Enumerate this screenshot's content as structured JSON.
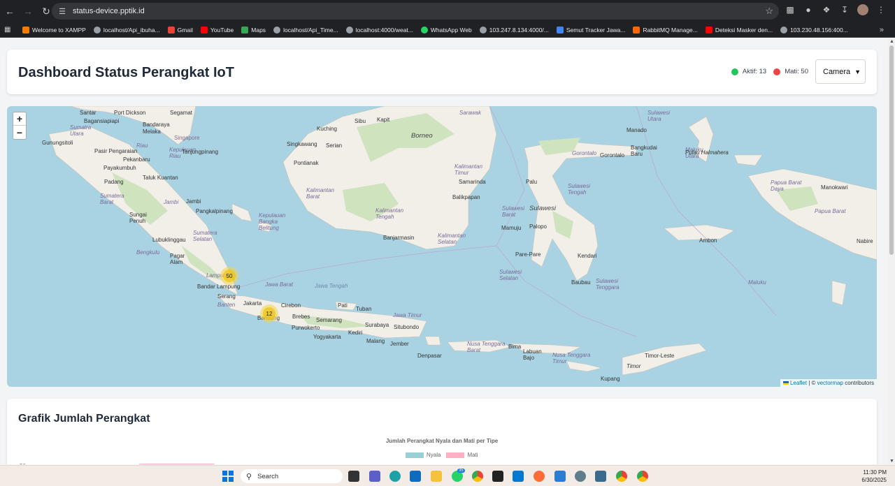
{
  "browser": {
    "url": "status-device.pptik.id",
    "bookmarks": [
      {
        "label": "Welcome to XAMPP",
        "color": "#f57c00"
      },
      {
        "label": "localhost/Api_ibuha...",
        "color": "#9aa0a6"
      },
      {
        "label": "Gmail",
        "color": "#ea4335"
      },
      {
        "label": "YouTube",
        "color": "#ff0000"
      },
      {
        "label": "Maps",
        "color": "#34a853"
      },
      {
        "label": "localhost/Api_Time...",
        "color": "#9aa0a6"
      },
      {
        "label": "localhost:4000/weat...",
        "color": "#9aa0a6"
      },
      {
        "label": "WhatsApp Web",
        "color": "#25d366"
      },
      {
        "label": "103.247.8.134:4000/...",
        "color": "#9aa0a6"
      },
      {
        "label": "Semut Tracker Jawa...",
        "color": "#4285f4"
      },
      {
        "label": "RabbitMQ Manage...",
        "color": "#ff6600"
      },
      {
        "label": "Deteksi Masker den...",
        "color": "#ff0000"
      },
      {
        "label": "103.230.48.156:400...",
        "color": "#9aa0a6"
      }
    ]
  },
  "header": {
    "title": "Dashboard Status Perangkat IoT",
    "active_label": "Aktif: 13",
    "inactive_label": "Mati: 50",
    "active_color": "#22c55e",
    "inactive_color": "#ef4444",
    "device_type": "Camera"
  },
  "map": {
    "zoom_in": "+",
    "zoom_out": "−",
    "attribution_leaflet": "Leaflet",
    "attribution_sep": " | © ",
    "attribution_vm": "vectormap",
    "attribution_rest": " contributors",
    "clusters": [
      {
        "count": "50"
      },
      {
        "count": "12"
      }
    ],
    "labels": {
      "santar": "Santar",
      "port_dickson": "Port Dickson",
      "segamat": "Segamat",
      "bagansiapiapi": "Bagansiapiapi",
      "bandaraya_melaka": "Bandaraya\nMelaka",
      "singapore": "Singapore",
      "kuching": "Kuching",
      "sibu": "Sibu",
      "kapit": "Kapit",
      "borneo": "Borneo",
      "manado": "Manado",
      "gunungsitoli": "Gunungsitoli",
      "pasir_pengaraian": "Pasir Pengaraian",
      "tanjungpinang": "Tanjungpinang",
      "singkawang": "Singkawang",
      "serian": "Serian",
      "bangkudai_baru": "Bangkudai\nBaru",
      "gorontalo": "Gorontalo",
      "pekanbaru": "Pekanbaru",
      "payakumbuh": "Payakumbuh",
      "pontianak": "Pontianak",
      "samarinda": "Samarinda",
      "palu": "Palu",
      "manokwari": "Manokwari",
      "padang": "Padang",
      "taluk_kuantan": "Taluk Kuantan",
      "jambi": "Jambi",
      "balikpapan": "Balikpapan",
      "pangkalpinang": "Pangkalpinang",
      "sulawesi": "Sulawesi",
      "mamuju": "Mamuju",
      "palopo": "Palopo",
      "sungai_penuh": "Sungai\nPenuh",
      "banjarmasin": "Banjarmasin",
      "ambon": "Ambon",
      "nabire": "Nabire",
      "lubuklinggau": "Lubuklinggau",
      "pare_pare": "Pare-Pare",
      "kendari": "Kendari",
      "pagar_alam": "Pagar\nAlam",
      "baubau": "Baubau",
      "bandar_lampung": "Bandar Lampung",
      "serang": "Serang",
      "jakarta": "Jakarta",
      "cirebon": "Cirebon",
      "pati": "Pati",
      "tuban": "Tuban",
      "bandung": "Bandung",
      "brebes": "Brebes",
      "semarang": "Semarang",
      "surabaya": "Surabaya",
      "situbondo": "Situbondo",
      "purwokerto": "Purwokerto",
      "yogyakarta": "Yogyakarta",
      "kediri": "Kediri",
      "malang": "Malang",
      "jember": "Jember",
      "denpasar": "Denpasar",
      "bima": "Bima",
      "labuan_bajo": "Labuan\nBajo",
      "timor": "Timor",
      "timor_leste": "Timor-Leste",
      "kupang": "Kupang",
      "sumatera_barat": "Sumatera\nBarat",
      "riau": "Riau",
      "jambi_region": "Jambi",
      "bengkulu": "Bengkulu",
      "sumatera_selatan": "Sumatera\nSelatan",
      "lampung": "Lampung",
      "kepulauan_bangka": "Kepulauan\nBangka\nBelitung",
      "kalimantan_barat": "Kalimantan\nBarat",
      "kalimantan_tengah": "Kalimantan\nTengah",
      "kalimantan_selatan": "Kalimantan\nSelatan",
      "kalimantan_timur": "Kalimantan\nTimur",
      "sulawesi_tengah": "Sulawesi\nTengah",
      "sulawesi_barat": "Sulawesi\nBarat",
      "sulawesi_selatan": "Sulawesi\nSelatan",
      "sulawesi_tenggara": "Sulawesi\nTenggara",
      "sulawesi_utara": "Sulawesi\nUtara",
      "maluku": "Maluku",
      "maluku_utara": "Maluku\nUtara",
      "papua_barat": "Papua Barat",
      "papua_barat_daya": "Papua Barat\nDaya",
      "jawa_barat": "Jawa Barat",
      "jawa_tengah": "Jawa Tengah",
      "jawa_timur": "Jawa Timur",
      "banten": "Banten",
      "nusa_tenggara_barat": "Nusa Tenggara\nBarat",
      "nusa_tenggara_timur": "Nusa Tenggara\nTimur",
      "sarawak": "Sarawak",
      "kepulauan_riau": "Kepulauan\nRiau",
      "gorontalo_region": "Gorontalo",
      "pulau_halmahera": "Pulau Halmahera",
      "sumatra_utara": "Sumatra\nUtara"
    }
  },
  "chart_section": {
    "title": "Grafik Jumlah Perangkat",
    "chart_data": {
      "type": "bar",
      "title": "Jumlah Perangkat Nyala dan Mati per Tipe",
      "series": [
        {
          "name": "Nyala",
          "color": "#9ad0d5"
        },
        {
          "name": "Mati",
          "color": "#ffb1c1"
        }
      ],
      "visible_ytick": "50"
    }
  },
  "taskbar": {
    "search_placeholder": "Search",
    "time": "11:30 PM",
    "date": "6/30/2025",
    "whatsapp_badge": "35"
  }
}
